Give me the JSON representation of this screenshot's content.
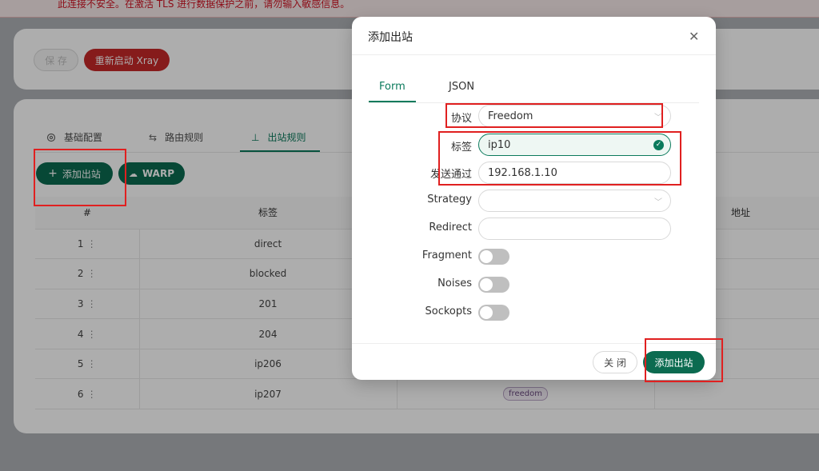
{
  "warning": {
    "text": "此连接不安全。在激活 TLS 进行数据保护之前，请勿输入敏感信息。"
  },
  "toolbar": {
    "save_label": "保 存",
    "restart_label": "重新启动 Xray"
  },
  "tabs": [
    {
      "label": "基础配置",
      "icon": "gear-icon"
    },
    {
      "label": "路由规则",
      "icon": "swap-icon"
    },
    {
      "label": "出站规则",
      "icon": "upload-icon",
      "active": true
    }
  ],
  "actions": {
    "add_label": "添加出站",
    "warp_label": "WARP"
  },
  "table": {
    "headers": {
      "index": "#",
      "tag": "标签",
      "address": "地址"
    },
    "rows": [
      {
        "index": "1",
        "tag": "direct"
      },
      {
        "index": "2",
        "tag": "blocked"
      },
      {
        "index": "3",
        "tag": "201"
      },
      {
        "index": "4",
        "tag": "204"
      },
      {
        "index": "5",
        "tag": "ip206"
      },
      {
        "index": "6",
        "tag": "ip207",
        "protocol": "freedom"
      }
    ]
  },
  "modal": {
    "title": "添加出站",
    "tabs": [
      "Form",
      "JSON"
    ],
    "fields": {
      "protocol": {
        "label": "协议",
        "value": "Freedom"
      },
      "tag": {
        "label": "标签",
        "value": "ip10"
      },
      "send_through": {
        "label": "发送通过",
        "value": "192.168.1.10"
      },
      "strategy": {
        "label": "Strategy",
        "value": ""
      },
      "redirect": {
        "label": "Redirect",
        "value": ""
      },
      "fragment": {
        "label": "Fragment"
      },
      "noises": {
        "label": "Noises"
      },
      "sockopts": {
        "label": "Sockopts"
      }
    },
    "buttons": {
      "close": "关 闭",
      "add": "添加出站"
    }
  },
  "colors": {
    "accent": "#0b6b50",
    "danger": "#c62828",
    "highlight": "#e02020"
  }
}
